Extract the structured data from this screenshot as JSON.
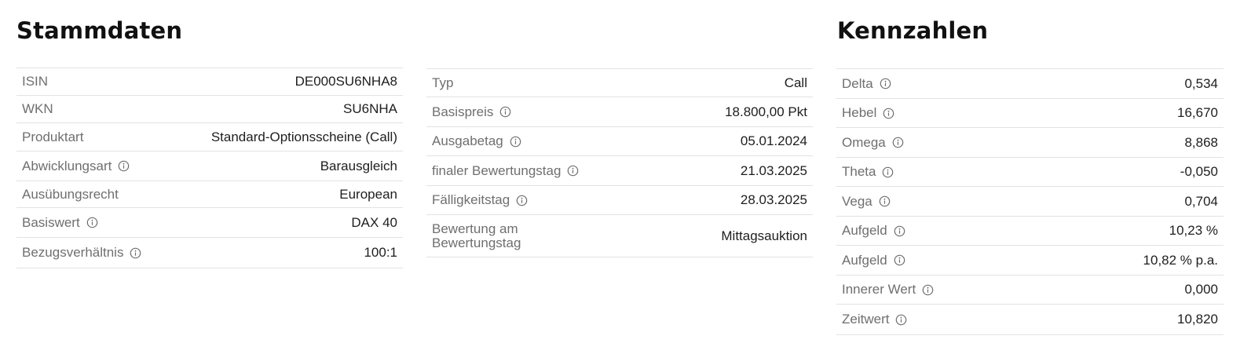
{
  "stammdaten": {
    "title": "Stammdaten",
    "rows": [
      {
        "label": "ISIN",
        "value": "DE000SU6NHA8",
        "info": false
      },
      {
        "label": "WKN",
        "value": "SU6NHA",
        "info": false
      },
      {
        "label": "Produktart",
        "value": "Standard-Optionsscheine (Call)",
        "info": false
      },
      {
        "label": "Abwicklungsart",
        "value": "Barausgleich",
        "info": true
      },
      {
        "label": "Ausübungsrecht",
        "value": "European",
        "info": false
      },
      {
        "label": "Basiswert",
        "value": "DAX 40",
        "info": true
      },
      {
        "label": "Bezugsverhältnis",
        "value": "100:1",
        "info": true
      }
    ]
  },
  "stammdaten2": {
    "rows": [
      {
        "label": "Typ",
        "value": "Call",
        "info": false
      },
      {
        "label": "Basispreis",
        "value": "18.800,00 Pkt",
        "info": true
      },
      {
        "label": "Ausgabetag",
        "value": "05.01.2024",
        "info": true
      },
      {
        "label": "finaler Bewertungstag",
        "value": "21.03.2025",
        "info": true
      },
      {
        "label": "Fälligkeitstag",
        "value": "28.03.2025",
        "info": true
      },
      {
        "label": "Bewertung am",
        "label2": "Bewertungstag",
        "value": "Mittagsauktion",
        "info": false
      }
    ]
  },
  "kennzahlen": {
    "title": "Kennzahlen",
    "rows": [
      {
        "label": "Delta",
        "value": "0,534",
        "info": true
      },
      {
        "label": "Hebel",
        "value": "16,670",
        "info": true
      },
      {
        "label": "Omega",
        "value": "8,868",
        "info": true
      },
      {
        "label": "Theta",
        "value": "-0,050",
        "info": true
      },
      {
        "label": "Vega",
        "value": "0,704",
        "info": true
      },
      {
        "label": "Aufgeld",
        "value": "10,23 %",
        "info": true
      },
      {
        "label": "Aufgeld",
        "value": "10,82 % p.a.",
        "info": true
      },
      {
        "label": "Innerer Wert",
        "value": "0,000",
        "info": true
      },
      {
        "label": "Zeitwert",
        "value": "10,820",
        "info": true
      }
    ]
  },
  "colors": {
    "label": "#6f6f6f",
    "value": "#1e1e1e",
    "divider": "#e2e2e2",
    "title": "#111111"
  },
  "icons": {
    "info": "info-circle-icon"
  }
}
